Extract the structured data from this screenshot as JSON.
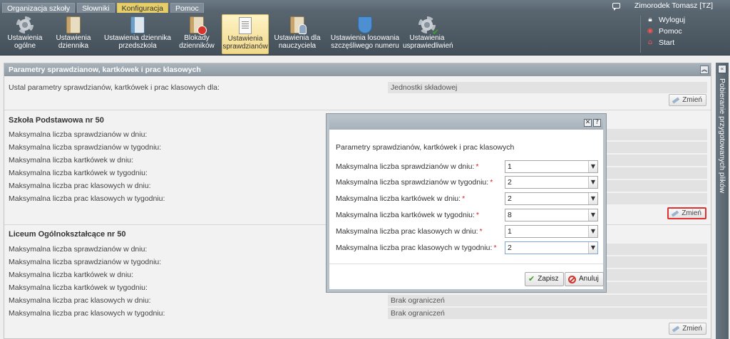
{
  "topmenu": {
    "items": [
      "Organizacja szkoły",
      "Słowniki",
      "Konfiguracja",
      "Pomoc"
    ],
    "active": "Konfiguracja",
    "user": "Zimorodek Tomasz [TZ]"
  },
  "toolbar": {
    "items": [
      {
        "line1": "Ustawienia",
        "line2": "ogólne",
        "icon": "gear-icon"
      },
      {
        "line1": "Ustawienia",
        "line2": "dziennika",
        "icon": "book-icon"
      },
      {
        "line1": "Ustawienia dziennika",
        "line2": "przedszkola",
        "icon": "book-icon"
      },
      {
        "line1": "Blokady",
        "line2": "dzienników",
        "icon": "lock-book-icon"
      },
      {
        "line1": "Ustawienia",
        "line2": "sprawdzianów",
        "icon": "document-icon"
      },
      {
        "line1": "Ustawienia dla",
        "line2": "nauczyciela",
        "icon": "teacher-book-icon"
      },
      {
        "line1": "Ustawienia losowania",
        "line2": "szczęśliwego numeru",
        "icon": "shield-icon"
      },
      {
        "line1": "Ustawienia",
        "line2": "usprawiedliwień",
        "icon": "gear-check-icon"
      }
    ],
    "right_links": [
      {
        "label": "Wyloguj",
        "icon": "lock-icon"
      },
      {
        "label": "Pomoc",
        "icon": "lifebuoy-icon"
      },
      {
        "label": "Start",
        "icon": "home-icon"
      }
    ]
  },
  "panel": {
    "title": "Parametry sprawdzianow, kartkówek i prac klasowych",
    "scope_label": "Ustal parametry sprawdzianów, kartkówek i prac klasowych dla:",
    "scope_value": "Jednostki składowej",
    "change_label": "Zmień",
    "sections": [
      {
        "name": "Szkoła Podstawowa nr 50",
        "rows": [
          {
            "label": "Maksymalna liczba sprawdzianów w dniu:",
            "value": ""
          },
          {
            "label": "Maksymalna liczba sprawdzianów w tygodniu:",
            "value": ""
          },
          {
            "label": "Maksymalna liczba kartkówek w dniu:",
            "value": ""
          },
          {
            "label": "Maksymalna liczba kartkówek w tygodniu:",
            "value": ""
          },
          {
            "label": "Maksymalna liczba prac klasowych w dniu:",
            "value": ""
          },
          {
            "label": "Maksymalna liczba prac klasowych w tygodniu:",
            "value": ""
          }
        ]
      },
      {
        "name": "Liceum Ogólnokształcące nr 50",
        "rows": [
          {
            "label": "Maksymalna liczba sprawdzianów w dniu:",
            "value": ""
          },
          {
            "label": "Maksymalna liczba sprawdzianów w tygodniu:",
            "value": ""
          },
          {
            "label": "Maksymalna liczba kartkówek w dniu:",
            "value": ""
          },
          {
            "label": "Maksymalna liczba kartkówek w tygodniu:",
            "value": ""
          },
          {
            "label": "Maksymalna liczba prac klasowych w dniu:",
            "value": "Brak ograniczeń"
          },
          {
            "label": "Maksymalna liczba prac klasowych w tygodniu:",
            "value": "Brak ograniczeń"
          }
        ]
      }
    ]
  },
  "side_tab": {
    "label": "Pobieranie przygotowanych plików"
  },
  "dialog": {
    "heading": "Parametry sprawdzianów, kartkówek i prac klasowych",
    "fields": [
      {
        "label": "Maksymalna liczba sprawdzianów w dniu:",
        "value": "1"
      },
      {
        "label": "Maksymalna liczba sprawdzianów w tygodniu:",
        "value": "2"
      },
      {
        "label": "Maksymalna liczba kartkówek w dniu:",
        "value": "2"
      },
      {
        "label": "Maksymalna liczba kartkówek w tygodniu:",
        "value": "8"
      },
      {
        "label": "Maksymalna liczba prac klasowych w dniu:",
        "value": "1"
      },
      {
        "label": "Maksymalna liczba prac klasowych w tygodniu:",
        "value": "2"
      }
    ],
    "save_label": "Zapisz",
    "cancel_label": "Anuluj",
    "close_symbol": "✕",
    "help_symbol": "?"
  },
  "colors": {
    "accent": "#e6cf6a",
    "highlight_border": "#e03030"
  }
}
